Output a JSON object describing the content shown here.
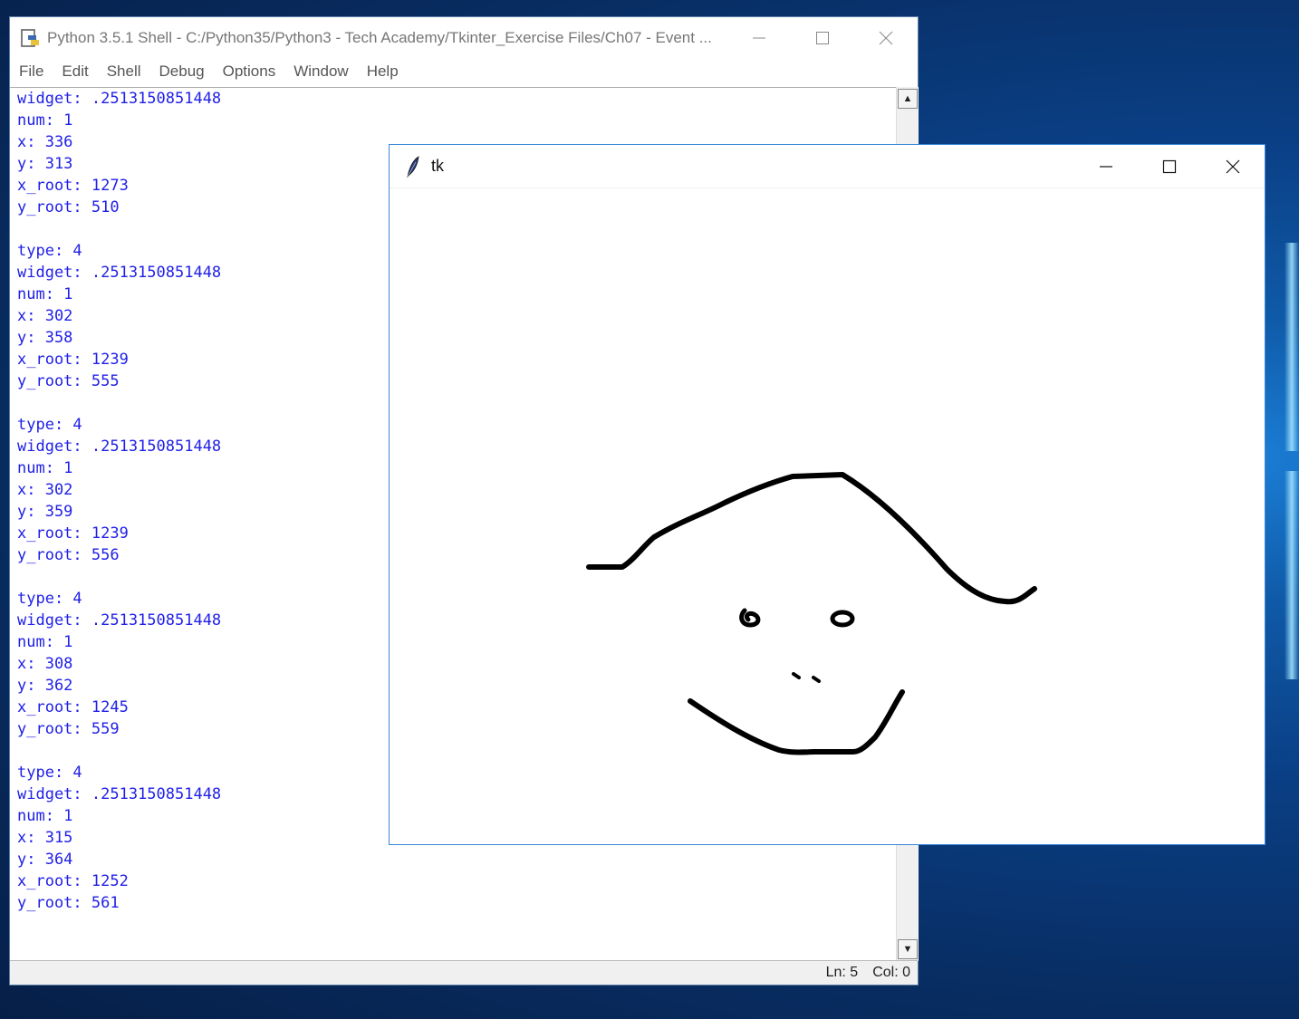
{
  "idle_window": {
    "title": "Python 3.5.1 Shell - C:/Python35/Python3 - Tech Academy/Tkinter_Exercise Files/Ch07 - Event ...",
    "menu": [
      "File",
      "Edit",
      "Shell",
      "Debug",
      "Options",
      "Window",
      "Help"
    ],
    "output_lines": [
      "widget: .2513150851448",
      "num: 1",
      "x: 336",
      "y: 313",
      "x_root: 1273",
      "y_root: 510",
      "",
      "type: 4",
      "widget: .2513150851448",
      "num: 1",
      "x: 302",
      "y: 358",
      "x_root: 1239",
      "y_root: 555",
      "",
      "type: 4",
      "widget: .2513150851448",
      "num: 1",
      "x: 302",
      "y: 359",
      "x_root: 1239",
      "y_root: 556",
      "",
      "type: 4",
      "widget: .2513150851448",
      "num: 1",
      "x: 308",
      "y: 362",
      "x_root: 1245",
      "y_root: 559",
      "",
      "type: 4",
      "widget: .2513150851448",
      "num: 1",
      "x: 315",
      "y: 364",
      "x_root: 1252",
      "y_root: 561"
    ],
    "status": {
      "line": "Ln: 5",
      "col": "Col: 0"
    }
  },
  "tk_window": {
    "title": "tk"
  },
  "colors": {
    "output_text": "#2020e8",
    "drawing_stroke": "#000000",
    "tk_border": "#3a86d9"
  },
  "icons": {
    "minimize": "minimize-icon",
    "maximize": "maximize-icon",
    "close": "close-icon",
    "tk_app": "feather-icon",
    "idle_app": "python-idle-icon"
  }
}
